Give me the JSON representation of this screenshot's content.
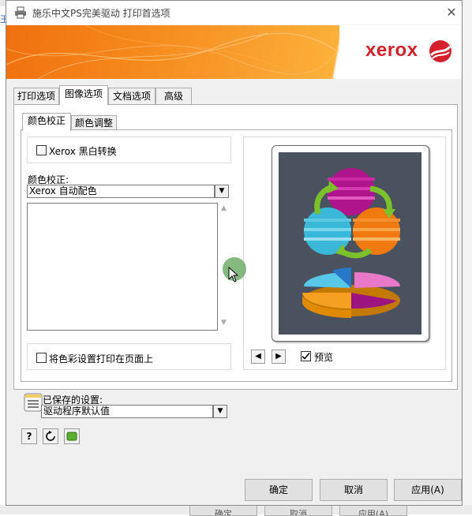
{
  "window": {
    "title": "施乐中文PS完美驱动 打印首选项",
    "close_glyph": "✕"
  },
  "banner": {
    "brand": "xerox"
  },
  "tabs": [
    {
      "label": "打印选项"
    },
    {
      "label": "图像选项"
    },
    {
      "label": "文档选项"
    },
    {
      "label": "高级"
    }
  ],
  "active_tab": "图像选项",
  "subtabs": [
    {
      "label": "颜色校正"
    },
    {
      "label": "颜色调整"
    }
  ],
  "active_subtab": "颜色校正",
  "image_options": {
    "bw_convert": {
      "label": "Xerox 黑白转换",
      "checked": false
    },
    "color_correction_label": "颜色校正:",
    "color_correction_value": "Xerox 自动配色",
    "print_color_settings": {
      "label": "将色彩设置打印在页面上",
      "checked": false
    },
    "preview": {
      "label": "预览",
      "checked": true
    }
  },
  "saved_settings": {
    "label": "已保存的设置:",
    "value": "驱动程序默认值"
  },
  "buttons": {
    "ok": "确定",
    "cancel": "取消",
    "apply": "应用(A)",
    "help": "?"
  },
  "background_fragments": {
    "left_glyph": "王",
    "bottom_buttons": [
      "确定",
      "取消",
      "应用(A)"
    ]
  },
  "colors": {
    "banner_orange": "#f58a1c",
    "brand_red": "#d5212b",
    "preview_bg": "#4a5260",
    "magenta": "#b0148c",
    "orange": "#f07a10",
    "cyan": "#3ab8d8",
    "green": "#7cc02c"
  }
}
